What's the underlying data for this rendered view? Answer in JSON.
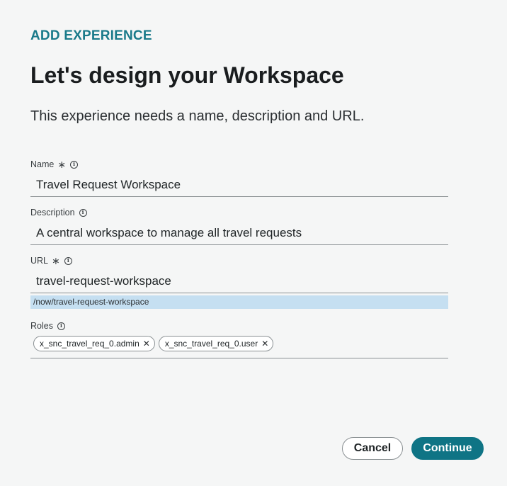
{
  "header": {
    "step_label": "ADD EXPERIENCE",
    "title": "Let's design your Workspace",
    "subtitle": "This experience needs a name, description and URL."
  },
  "form": {
    "name": {
      "label": "Name",
      "required_mark": "∗",
      "value": "Travel Request Workspace"
    },
    "description": {
      "label": "Description",
      "value": "A central workspace to manage all travel requests"
    },
    "url": {
      "label": "URL",
      "required_mark": "∗",
      "value": "travel-request-workspace",
      "hint": "/now/travel-request-workspace"
    },
    "roles": {
      "label": "Roles",
      "chips": [
        {
          "label": "x_snc_travel_req_0.admin"
        },
        {
          "label": "x_snc_travel_req_0.user"
        }
      ]
    }
  },
  "icons": {
    "info": "info-icon",
    "close": "close-icon"
  },
  "actions": {
    "cancel_label": "Cancel",
    "continue_label": "Continue"
  },
  "colors": {
    "accent": "#0f7485",
    "step_label": "#1a7a8a",
    "hint_bg": "#c5dff1",
    "background": "#f5f6f6"
  }
}
